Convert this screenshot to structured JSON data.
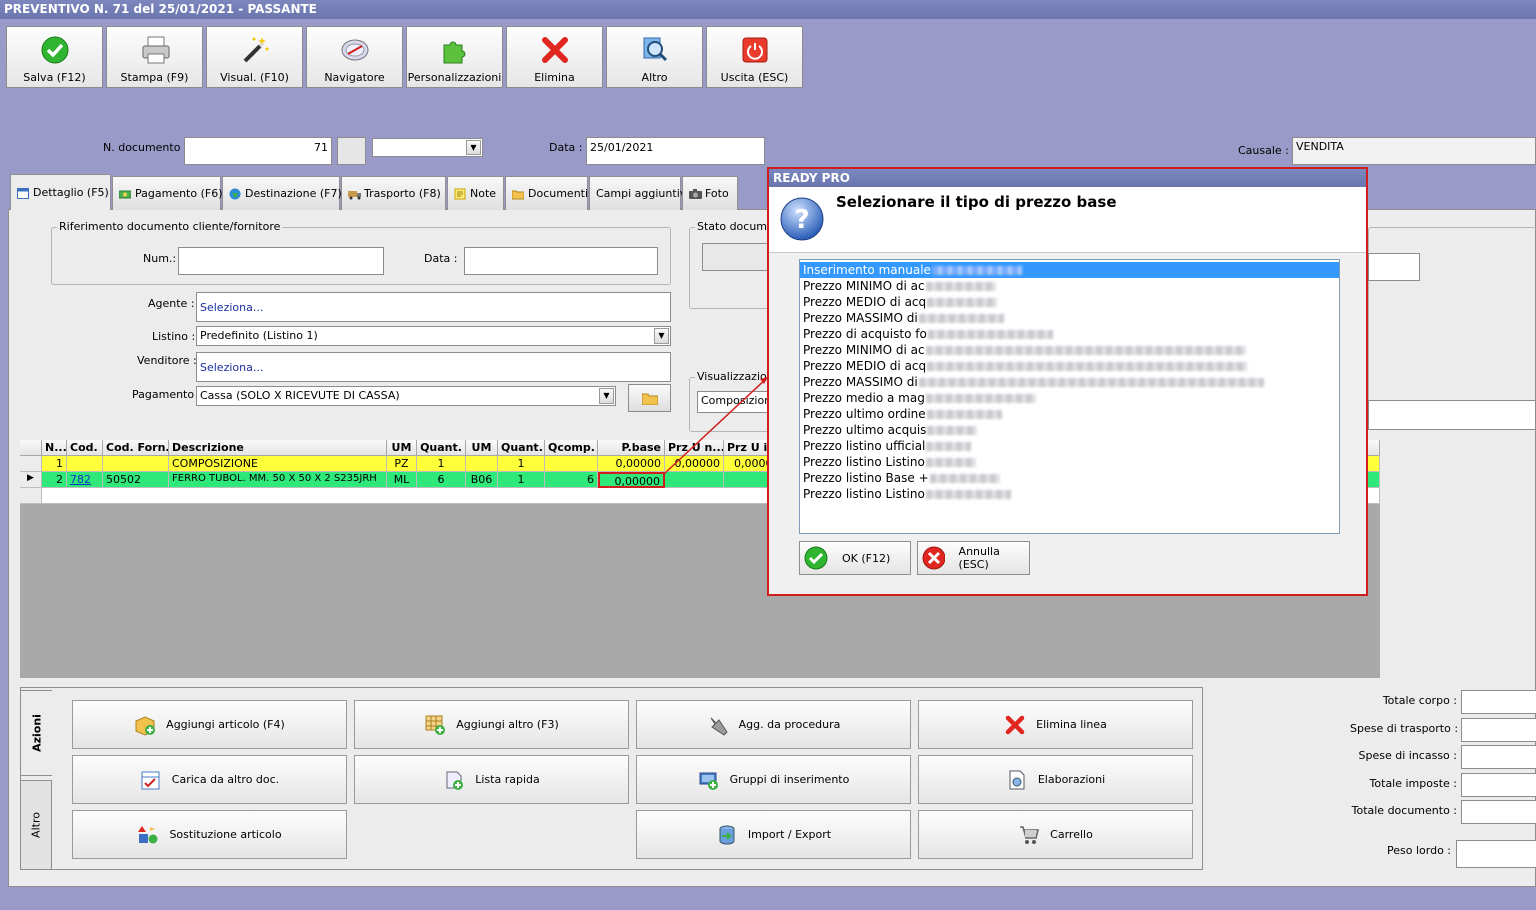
{
  "window": {
    "title": "PREVENTIVO N. 71 del 25/01/2021 - PASSANTE"
  },
  "toolbar": [
    {
      "label": "Salva (F12)",
      "icon": "check-icon"
    },
    {
      "label": "Stampa (F9)",
      "icon": "printer-icon"
    },
    {
      "label": "Visual. (F10)",
      "icon": "magic-wand-icon"
    },
    {
      "label": "Navigatore",
      "icon": "compass-icon"
    },
    {
      "label": "Personalizzazioni",
      "icon": "puzzle-icon"
    },
    {
      "label": "Elimina",
      "icon": "delete-x-icon"
    },
    {
      "label": "Altro",
      "icon": "magnifier-icon"
    },
    {
      "label": "Uscita (ESC)",
      "icon": "power-icon"
    }
  ],
  "header": {
    "ndoc_label": "N. documento :",
    "ndoc_value": "71",
    "data_label": "Data :",
    "data_value": "25/01/2021",
    "causale_label": "Causale :",
    "causale_value": "VENDITA"
  },
  "tabs": [
    {
      "label": "Dettaglio (F5)",
      "icon": "calendar-icon"
    },
    {
      "label": "Pagamento (F6)",
      "icon": "money-icon"
    },
    {
      "label": "Destinazione (F7)",
      "icon": "globe-icon"
    },
    {
      "label": "Trasporto (F8)",
      "icon": "truck-icon"
    },
    {
      "label": "Note",
      "icon": "note-icon"
    },
    {
      "label": "Documenti",
      "icon": "folder-icon"
    },
    {
      "label": "Campi aggiuntivi",
      "icon": ""
    },
    {
      "label": "Foto",
      "icon": "camera-icon"
    }
  ],
  "form": {
    "rif_group_title": "Riferimento documento cliente/fornitore",
    "num_label": "Num.:",
    "num_value": "",
    "rif_data_label": "Data :",
    "rif_data_value": "",
    "agente_label": "Agente :",
    "agente_value": "Seleziona...",
    "listino_label": "Listino :",
    "listino_value": "Predefinito (Listino 1)",
    "venditore_label": "Venditore :",
    "venditore_value": "Seleziona...",
    "pagamento_label": "Pagamento :",
    "pagamento_value": "Cassa (SOLO X RICEVUTE DI CASSA)",
    "stato_label": "Stato documen",
    "visualizzazione_label": "Visualizzazion",
    "visualizzazione_value": "Composizione"
  },
  "grid": {
    "columns": [
      "N...",
      "Cod.",
      "Cod. Forn.",
      "Descrizione",
      "UM",
      "Quant.",
      "UM",
      "Quant.",
      "Qcomp.",
      "P.base",
      "Prz U n...",
      "Prz U i"
    ],
    "rows": [
      {
        "cells": [
          "1",
          "",
          "",
          "COMPOSIZIONE",
          "PZ",
          "1",
          "",
          "1",
          "",
          "0,00000",
          "0,00000",
          "0,0000"
        ],
        "style": "yellow"
      },
      {
        "cells": [
          "2",
          "782",
          "50502",
          "FERRO TUBOL. MM.  50 X  50 X 2 S235JRH",
          "ML",
          "6",
          "B06",
          "1",
          "6",
          "0,00000",
          "",
          ""
        ],
        "style": "green"
      }
    ]
  },
  "actions": {
    "tab_azioni": "Azioni",
    "tab_altro": "Altro",
    "buttons": [
      {
        "label": "Aggiungi articolo (F4)",
        "icon": "add-box-icon"
      },
      {
        "label": "Aggiungi altro (F3)",
        "icon": "add-grid-icon"
      },
      {
        "label": "Agg. da procedura",
        "icon": "wrench-icon"
      },
      {
        "label": "Elimina linea",
        "icon": "delete-x-icon"
      },
      {
        "label": "Carica da altro doc.",
        "icon": "checklist-icon"
      },
      {
        "label": "Lista rapida",
        "icon": "quick-list-icon"
      },
      {
        "label": "Gruppi di inserimento",
        "icon": "group-add-icon"
      },
      {
        "label": "Elaborazioni",
        "icon": "document-gear-icon"
      },
      {
        "label": "Sostituzione articolo",
        "icon": "swap-shapes-icon"
      },
      {
        "label": "Import / Export",
        "icon": "import-export-icon"
      },
      {
        "label": "Carrello",
        "icon": "cart-icon"
      }
    ]
  },
  "totals": [
    {
      "label": "Totale corpo :"
    },
    {
      "label": "Spese di trasporto :"
    },
    {
      "label": "Spese di incasso :"
    },
    {
      "label": "Totale imposte :"
    },
    {
      "label": "Totale documento :"
    },
    {
      "label": "Peso lordo :"
    }
  ],
  "dialog": {
    "title": "READY PRO",
    "question": "Selezionare il tipo di prezzo base",
    "items": [
      {
        "label": "Inserimento manuale",
        "blur": 90,
        "selected": true
      },
      {
        "label": "Prezzo MINIMO di ac",
        "blur": 70
      },
      {
        "label": "Prezzo MEDIO di acq",
        "blur": 70
      },
      {
        "label": "Prezzo MASSIMO di",
        "blur": 85
      },
      {
        "label": "Prezzo di acquisto fo",
        "blur": 125
      },
      {
        "label": "Prezzo MINIMO di ac",
        "blur": 320
      },
      {
        "label": "Prezzo MEDIO di acq",
        "blur": 320
      },
      {
        "label": "Prezzo MASSIMO di",
        "blur": 345
      },
      {
        "label": "Prezzo medio a mag",
        "blur": 110
      },
      {
        "label": "Prezzo ultimo ordine",
        "blur": 75
      },
      {
        "label": "Prezzo ultimo acquis",
        "blur": 50
      },
      {
        "label": "Prezzo listino ufficial",
        "blur": 45
      },
      {
        "label": "Prezzo listino Listino",
        "blur": 50
      },
      {
        "label": "Prezzo listino Base +",
        "blur": 70
      },
      {
        "label": "Prezzo listino Listino",
        "blur": 85
      }
    ],
    "ok_label": "OK (F12)",
    "cancel_label": "Annulla (ESC)"
  }
}
